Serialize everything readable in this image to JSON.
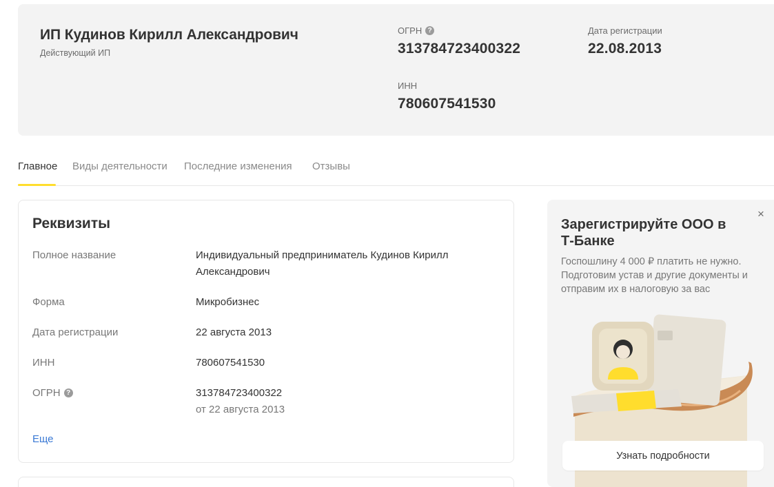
{
  "header": {
    "company_name": "ИП Кудинов Кирилл Александрович",
    "status": "Действующий ИП",
    "ogrn_label": "ОГРН",
    "ogrn_value": "313784723400322",
    "reg_date_label": "Дата регистрации",
    "reg_date_value": "22.08.2013",
    "inn_label": "ИНН",
    "inn_value": "780607541530"
  },
  "tabs": [
    {
      "label": "Главное",
      "active": true
    },
    {
      "label": "Виды деятельности",
      "active": false
    },
    {
      "label": "Последние изменения",
      "active": false
    },
    {
      "label": "Отзывы",
      "active": false
    }
  ],
  "requisites": {
    "title": "Реквизиты",
    "rows": [
      {
        "label": "Полное название",
        "value": "Индивидуальный предприниматель Кудинов Кирилл Александрович"
      },
      {
        "label": "Форма",
        "value": "Микробизнес"
      },
      {
        "label": "Дата регистрации",
        "value": "22 августа 2013"
      },
      {
        "label": "ИНН",
        "value": "780607541530"
      },
      {
        "label": "ОГРН",
        "value": "313784723400322",
        "sub": "от 22 августа 2013"
      }
    ],
    "more_label": "Еще"
  },
  "promo": {
    "title": "Зарегистрируйте ООО в Т-Банке",
    "text": "Госпошлину 4 000 ₽ платить не нужно. Подготовим устав и другие документы и отправим их в налоговую за вас",
    "button_label": "Узнать подробности",
    "close_glyph": "×"
  },
  "icons": {
    "help": "help-icon",
    "close": "close-icon"
  },
  "colors": {
    "accent": "#ffdd2d",
    "link": "#3a79d4",
    "header_bg": "#f3f3f3"
  }
}
